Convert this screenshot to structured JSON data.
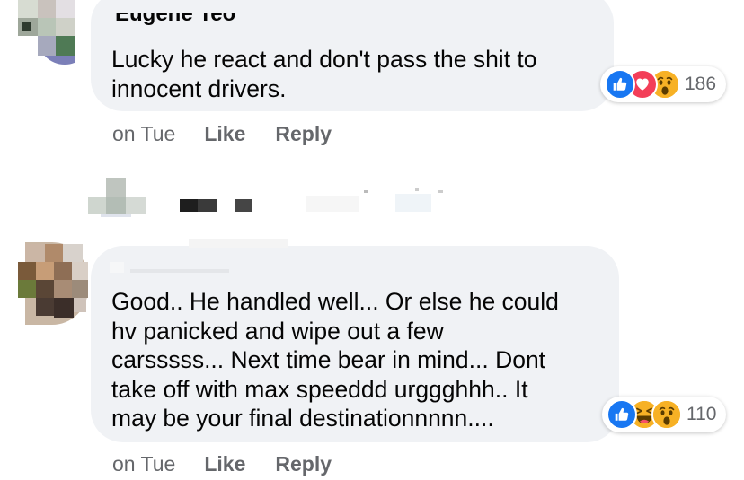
{
  "comments": [
    {
      "author": "Eugene Teo",
      "text": "Lucky he react and don't pass the shit to\ninnocent drivers.",
      "time": "on Tue",
      "like_label": "Like",
      "reply_label": "Reply",
      "reactions": [
        "like-icon",
        "love-icon",
        "wow-icon"
      ],
      "reaction_count": "186"
    },
    {
      "author": "",
      "text": "Good.. He handled well... Or else he could\nhv panicked and wipe out a few\ncarsssss... Next time bear in mind... Dont\ntake off with max speeddd urggghhh.. It\nmay be your final destinationnnnn....",
      "time": "on Tue",
      "like_label": "Like",
      "reply_label": "Reply",
      "reactions": [
        "like-icon",
        "haha-icon",
        "wow-icon"
      ],
      "reaction_count": "110"
    }
  ],
  "colors": {
    "bubble": "#f0f2f5",
    "meta_text": "#65676b",
    "like_blue": "#1877f2",
    "love_red": "#f33e58",
    "emoji_yellow": "#f7b125"
  }
}
